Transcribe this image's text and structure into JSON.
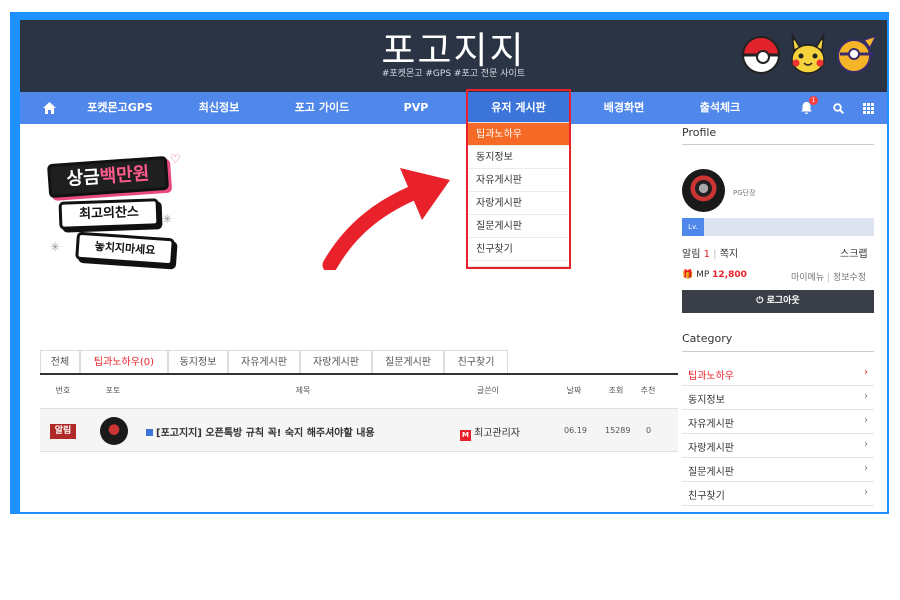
{
  "header": {
    "site_title": "포고지지",
    "site_subtitle": "#포켓몬고 #GPS #포고 전문 사이트"
  },
  "nav": {
    "items": [
      {
        "label": "포켓몬고GPS"
      },
      {
        "label": "최신정보"
      },
      {
        "label": "포고 가이드"
      },
      {
        "label": "PVP"
      },
      {
        "label": "유저 게시판"
      },
      {
        "label": "배경화면"
      },
      {
        "label": "출석체크"
      }
    ],
    "notification_count": "1"
  },
  "dropdown": {
    "items": [
      "팁과노하우",
      "동지정보",
      "자유게시판",
      "자랑게시판",
      "질문게시판",
      "친구찾기"
    ]
  },
  "promo": {
    "line1_a": "상금",
    "line1_b": "백만원",
    "line2": "최고의찬스",
    "line3": "놓치지마세요"
  },
  "board": {
    "tabs": [
      "전체",
      "팁과노하우(0)",
      "동지정보",
      "자유게시판",
      "자랑게시판",
      "질문게시판",
      "친구찾기"
    ],
    "columns": [
      "번호",
      "포토",
      "제목",
      "글쓴이",
      "날짜",
      "조회",
      "추천"
    ],
    "rows": [
      {
        "badge": "알림",
        "title": "[포고지지] 오픈톡방 규칙 꼭! 숙지 해주셔야할 내용",
        "author": "최고관리자",
        "date": "06.19",
        "views": "15289",
        "likes": "0"
      }
    ]
  },
  "sidebar": {
    "profile_title": "Profile",
    "nickname": "PG단장",
    "level_label": "Lv.",
    "alarm_label": "알림",
    "alarm_count": "1",
    "note_label": "쪽지",
    "scrap_label": "스크랩",
    "mp_label": "MP",
    "mp_value": "12,800",
    "mymenu_label": "마이메뉴",
    "edit_label": "정보수정",
    "logout_label": "로그아웃",
    "category_title": "Category",
    "categories": [
      "팁과노하우",
      "동지정보",
      "자유게시판",
      "자랑게시판",
      "질문게시판",
      "친구찾기"
    ]
  },
  "colors": {
    "header_bg": "#2b3444",
    "nav_bg": "#4f87ea",
    "accent_orange": "#f56a26",
    "accent_red": "#e8212a",
    "frame_blue": "#1e90ff"
  }
}
